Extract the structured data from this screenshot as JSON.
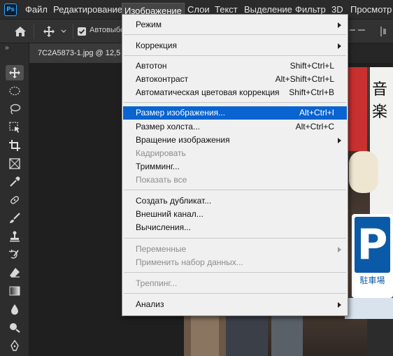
{
  "app": {
    "logo": "Ps"
  },
  "menubar": {
    "items": [
      {
        "label": "Файл"
      },
      {
        "label": "Редактирование"
      },
      {
        "label": "Изображение"
      },
      {
        "label": "Слои"
      },
      {
        "label": "Текст"
      },
      {
        "label": "Выделение"
      },
      {
        "label": "Фильтр"
      },
      {
        "label": "3D"
      },
      {
        "label": "Просмотр"
      }
    ],
    "active_index": 2
  },
  "options_bar": {
    "autoselect_label": "Автовыбо",
    "autoselect_checked": true
  },
  "document": {
    "tab_title": "7C2A5873-1.jpg @ 12,5"
  },
  "toolbar": {
    "collapse_label": "››",
    "tools": [
      "move-tool",
      "marquee-tool",
      "lasso-tool",
      "object-selection-tool",
      "crop-tool",
      "frame-tool",
      "eyedropper-tool",
      "healing-brush-tool",
      "brush-tool",
      "clone-stamp-tool",
      "history-brush-tool",
      "eraser-tool",
      "gradient-tool",
      "blur-tool",
      "dodge-tool",
      "pen-tool"
    ]
  },
  "image_menu": {
    "items": [
      {
        "label": "Режим",
        "shortcut": "",
        "submenu": true,
        "disabled": false
      },
      {
        "label": "Коррекция",
        "shortcut": "",
        "submenu": true,
        "disabled": false
      },
      {
        "label": "Автотон",
        "shortcut": "Shift+Ctrl+L",
        "submenu": false,
        "disabled": false
      },
      {
        "label": "Автоконтраст",
        "shortcut": "Alt+Shift+Ctrl+L",
        "submenu": false,
        "disabled": false
      },
      {
        "label": "Автоматическая цветовая коррекция",
        "shortcut": "Shift+Ctrl+B",
        "submenu": false,
        "disabled": false
      },
      {
        "label": "Размер изображения...",
        "shortcut": "Alt+Ctrl+I",
        "submenu": false,
        "disabled": false,
        "highlighted": true
      },
      {
        "label": "Размер холста...",
        "shortcut": "Alt+Ctrl+C",
        "submenu": false,
        "disabled": false
      },
      {
        "label": "Вращение изображения",
        "shortcut": "",
        "submenu": true,
        "disabled": false
      },
      {
        "label": "Кадрировать",
        "shortcut": "",
        "submenu": false,
        "disabled": true
      },
      {
        "label": "Тримминг...",
        "shortcut": "",
        "submenu": false,
        "disabled": false
      },
      {
        "label": "Показать все",
        "shortcut": "",
        "submenu": false,
        "disabled": true
      },
      {
        "label": "Создать дубликат...",
        "shortcut": "",
        "submenu": false,
        "disabled": false
      },
      {
        "label": "Внешний канал...",
        "shortcut": "",
        "submenu": false,
        "disabled": false
      },
      {
        "label": "Вычисления...",
        "shortcut": "",
        "submenu": false,
        "disabled": false
      },
      {
        "label": "Переменные",
        "shortcut": "",
        "submenu": true,
        "disabled": true
      },
      {
        "label": "Применить набор данных...",
        "shortcut": "",
        "submenu": false,
        "disabled": true
      },
      {
        "label": "Треппинг...",
        "shortcut": "",
        "submenu": false,
        "disabled": true
      },
      {
        "label": "Анализ",
        "shortcut": "",
        "submenu": true,
        "disabled": false
      }
    ]
  },
  "photo": {
    "visible_signage_text": [
      "P",
      "駐車場",
      "音",
      "楽"
    ]
  }
}
